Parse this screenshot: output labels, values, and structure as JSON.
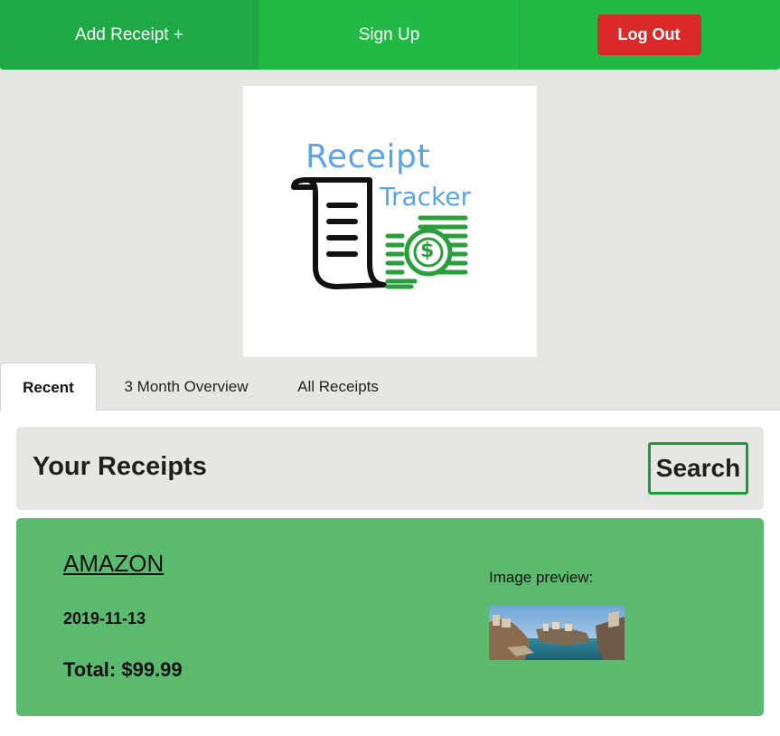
{
  "nav": {
    "add_receipt_label": "Add Receipt +",
    "sign_up_label": "Sign Up",
    "log_out_label": "Log Out"
  },
  "logo": {
    "line1": "Receipt",
    "line2": "Tracker",
    "dollar_symbol": "$"
  },
  "tabs": [
    {
      "label": "Recent",
      "active": true
    },
    {
      "label": "3 Month Overview",
      "active": false
    },
    {
      "label": "All Receipts",
      "active": false
    }
  ],
  "receipts_header": {
    "title": "Your Receipts",
    "search_label": "Search"
  },
  "receipt": {
    "vendor": "AMAZON",
    "date": "2019-11-13",
    "total": "Total: $99.99",
    "preview_label": "Image preview:"
  },
  "colors": {
    "nav_green": "#21ba45",
    "logout_red": "#db2828",
    "card_green": "#5cba6f",
    "panel_gray": "#e6e7e5"
  }
}
